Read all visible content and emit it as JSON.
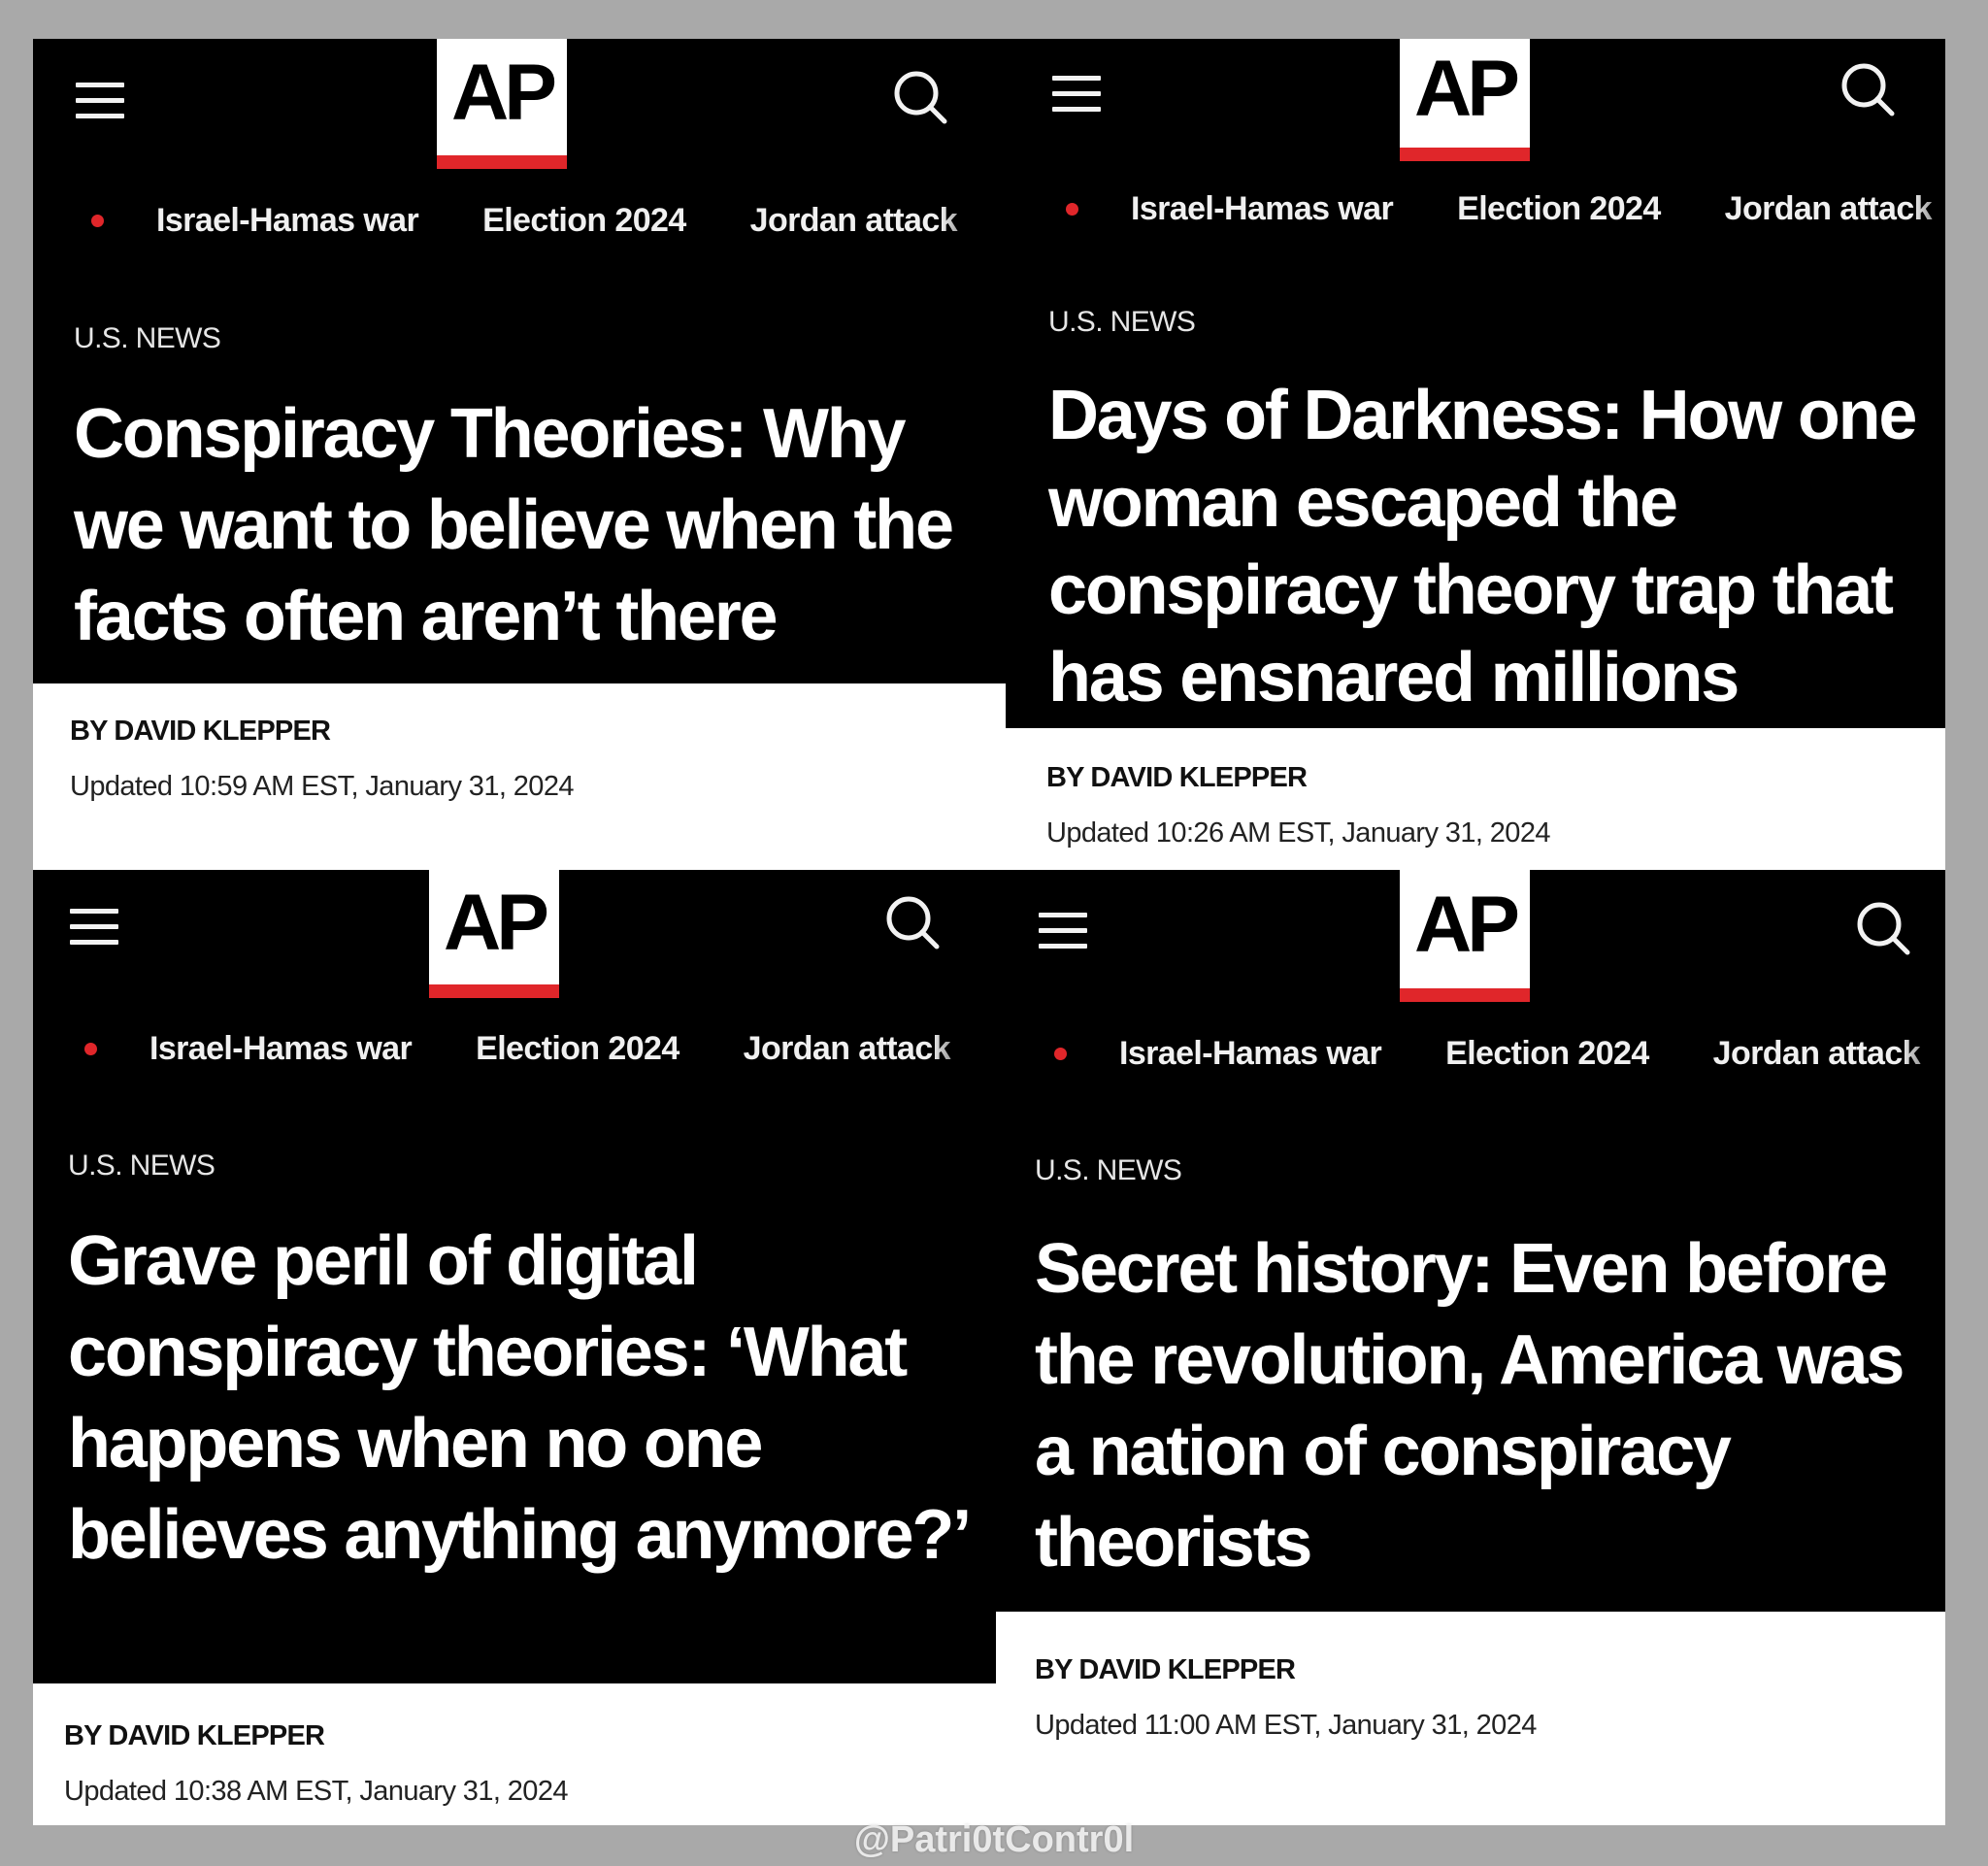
{
  "logo": "AP",
  "nav_items": [
    "Israel-Hamas war",
    "Election 2024",
    "Jordan attack"
  ],
  "panels": [
    {
      "section": "U.S. NEWS",
      "headline": "Conspiracy Theories: Why we want to believe when the facts often aren’t there",
      "byline": "BY DAVID KLEPPER",
      "updated": "Updated 10:59 AM EST, January 31, 2024"
    },
    {
      "section": "U.S. NEWS",
      "headline": "Days of Darkness: How one woman escaped the conspiracy theory trap that has ensnared millions",
      "byline": "BY DAVID KLEPPER",
      "updated": "Updated 10:26 AM EST, January 31, 2024"
    },
    {
      "section": "U.S. NEWS",
      "headline": "Grave peril of digital conspiracy theories: ‘What happens when no one believes anything anymore?’",
      "byline": "BY DAVID KLEPPER",
      "updated": "Updated 10:38 AM EST, January 31, 2024"
    },
    {
      "section": "U.S. NEWS",
      "headline": "Secret history: Even before the revolution, America was a nation of conspiracy theorists",
      "byline": "BY DAVID KLEPPER",
      "updated": "Updated 11:00 AM EST, January 31, 2024"
    }
  ],
  "watermark": "@Patri0tContr0l",
  "colors": {
    "accent_red": "#e0262a",
    "header_bg": "#000000",
    "page_bg": "#a9a9a9"
  }
}
